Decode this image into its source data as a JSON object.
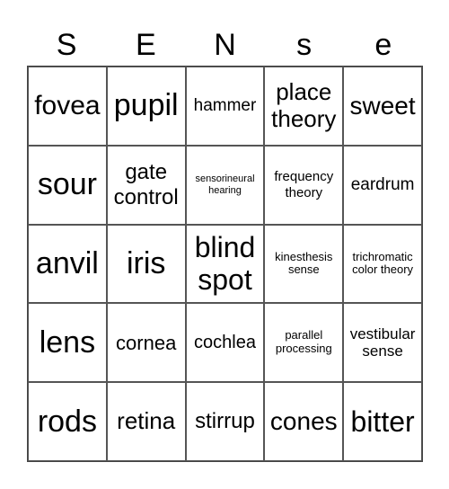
{
  "header": [
    "S",
    "E",
    "N",
    "s",
    "e"
  ],
  "cells": [
    "fovea",
    "pupil",
    "hammer",
    "place theory",
    "sweet",
    "sour",
    "gate control",
    "sensorineural hearing",
    "frequency theory",
    "eardrum",
    "anvil",
    "iris",
    "blind spot",
    "kinesthesis sense",
    "trichromatic color theory",
    "lens",
    "cornea",
    "cochlea",
    "parallel processing",
    "vestibular sense",
    "rods",
    "retina",
    "stirrup",
    "cones",
    "bitter"
  ]
}
